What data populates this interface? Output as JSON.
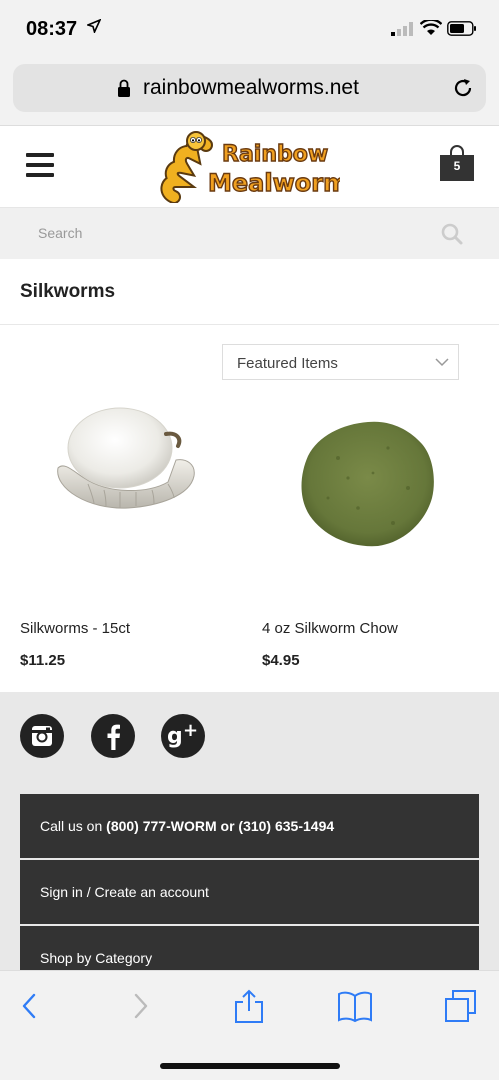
{
  "status_bar": {
    "time": "08:37",
    "location_icon": "location-arrow-icon",
    "signal_icon": "cellular-signal-icon",
    "wifi_icon": "wifi-icon",
    "battery_icon": "battery-icon"
  },
  "browser": {
    "url": "rainbowmealworms.net",
    "lock_icon": "lock-icon",
    "reload_icon": "reload-icon"
  },
  "header": {
    "menu_icon": "hamburger-menu-icon",
    "logo_line1": "Rainbow",
    "logo_line2": "Mealworms",
    "cart_icon": "shopping-bag-icon",
    "cart_count": "5"
  },
  "search": {
    "placeholder": "Search",
    "icon": "search-icon"
  },
  "page": {
    "title": "Silkworms"
  },
  "sort": {
    "selected": "Featured Items",
    "icon": "chevron-down-icon"
  },
  "products": [
    {
      "name": "Silkworms - 15ct",
      "price": "$11.25",
      "image": "silkworm-cocoon-image"
    },
    {
      "name": "4 oz Silkworm Chow",
      "price": "$4.95",
      "image": "silkworm-chow-powder-image"
    }
  ],
  "footer": {
    "social": [
      "instagram-icon",
      "facebook-icon",
      "google-plus-icon"
    ],
    "call_prefix": "Call us on ",
    "call_numbers": "(800) 777-WORM or (310) 635-1494",
    "signin": "Sign in / Create an account",
    "shop_by_category": "Shop by Category"
  },
  "toolbar": {
    "back_icon": "back-chevron-icon",
    "forward_icon": "forward-chevron-icon",
    "share_icon": "share-icon",
    "bookmarks_icon": "bookmarks-icon",
    "tabs_icon": "tabs-icon"
  },
  "colors": {
    "logo_orange": "#f0a020",
    "footer_dark": "#333333",
    "safari_blue": "#2f7cf6"
  }
}
